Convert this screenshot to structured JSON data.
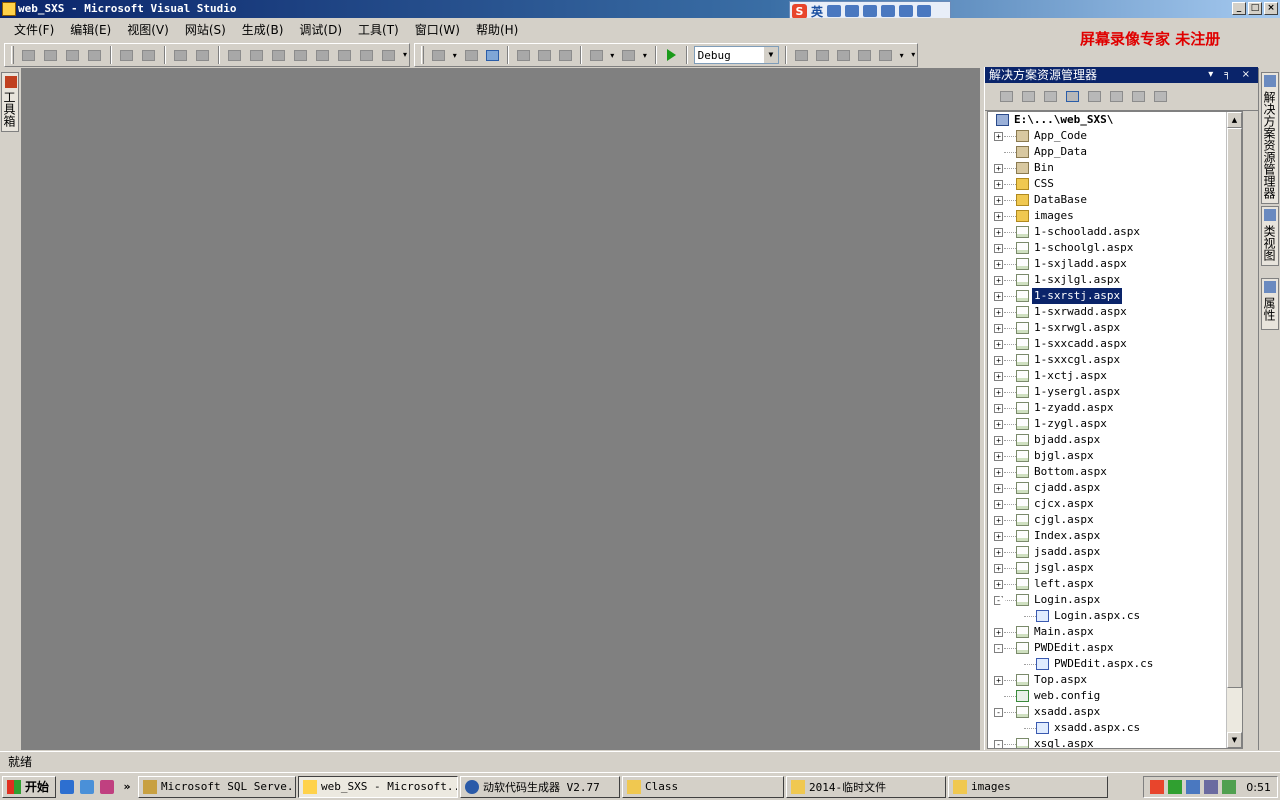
{
  "window": {
    "title": "web_SXS - Microsoft Visual Studio",
    "controls": [
      "_",
      "□",
      "×"
    ]
  },
  "ime_bar": {
    "logo": "S",
    "lang": "英"
  },
  "watermark": "屏幕录像专家  未注册",
  "menu": [
    "文件(F)",
    "编辑(E)",
    "视图(V)",
    "网站(S)",
    "生成(B)",
    "调试(D)",
    "工具(T)",
    "窗口(W)",
    "帮助(H)"
  ],
  "toolbar": {
    "config_value": "Debug",
    "overflow_label": "▾"
  },
  "toolbox": {
    "label": "工具箱"
  },
  "solution_explorer": {
    "title": "解决方案资源管理器",
    "title_controls": "▾ ╕ ×",
    "root": "E:\\...\\web_SXS\\",
    "items": [
      {
        "label": "App_Code",
        "icon": "folder-special-icon",
        "expand": "+"
      },
      {
        "label": "App_Data",
        "icon": "folder-special-icon",
        "expand": ""
      },
      {
        "label": "Bin",
        "icon": "folder-special-icon",
        "expand": "+"
      },
      {
        "label": "CSS",
        "icon": "folder-icon",
        "expand": "+"
      },
      {
        "label": "DataBase",
        "icon": "folder-icon",
        "expand": "+"
      },
      {
        "label": "images",
        "icon": "folder-icon",
        "expand": "+"
      },
      {
        "label": "1-schooladd.aspx",
        "icon": "aspx-page-icon",
        "expand": "+"
      },
      {
        "label": "1-schoolgl.aspx",
        "icon": "aspx-page-icon",
        "expand": "+"
      },
      {
        "label": "1-sxjladd.aspx",
        "icon": "aspx-page-icon",
        "expand": "+"
      },
      {
        "label": "1-sxjlgl.aspx",
        "icon": "aspx-page-icon",
        "expand": "+"
      },
      {
        "label": "1-sxrstj.aspx",
        "icon": "aspx-page-icon",
        "expand": "+",
        "selected": true
      },
      {
        "label": "1-sxrwadd.aspx",
        "icon": "aspx-page-icon",
        "expand": "+"
      },
      {
        "label": "1-sxrwgl.aspx",
        "icon": "aspx-page-icon",
        "expand": "+"
      },
      {
        "label": "1-sxxcadd.aspx",
        "icon": "aspx-page-icon",
        "expand": "+"
      },
      {
        "label": "1-sxxcgl.aspx",
        "icon": "aspx-page-icon",
        "expand": "+"
      },
      {
        "label": "1-xctj.aspx",
        "icon": "aspx-page-icon",
        "expand": "+"
      },
      {
        "label": "1-ysergl.aspx",
        "icon": "aspx-page-icon",
        "expand": "+"
      },
      {
        "label": "1-zyadd.aspx",
        "icon": "aspx-page-icon",
        "expand": "+"
      },
      {
        "label": "1-zygl.aspx",
        "icon": "aspx-page-icon",
        "expand": "+"
      },
      {
        "label": "bjadd.aspx",
        "icon": "aspx-page-icon",
        "expand": "+"
      },
      {
        "label": "bjgl.aspx",
        "icon": "aspx-page-icon",
        "expand": "+"
      },
      {
        "label": "Bottom.aspx",
        "icon": "aspx-page-icon",
        "expand": "+"
      },
      {
        "label": "cjadd.aspx",
        "icon": "aspx-page-icon",
        "expand": "+"
      },
      {
        "label": "cjcx.aspx",
        "icon": "aspx-page-icon",
        "expand": "+"
      },
      {
        "label": "cjgl.aspx",
        "icon": "aspx-page-icon",
        "expand": "+"
      },
      {
        "label": "Index.aspx",
        "icon": "aspx-page-icon",
        "expand": "+"
      },
      {
        "label": "jsadd.aspx",
        "icon": "aspx-page-icon",
        "expand": "+"
      },
      {
        "label": "jsgl.aspx",
        "icon": "aspx-page-icon",
        "expand": "+"
      },
      {
        "label": "left.aspx",
        "icon": "aspx-page-icon",
        "expand": "+"
      },
      {
        "label": "Login.aspx",
        "icon": "aspx-page-icon",
        "expand": "-"
      },
      {
        "label": "Login.aspx.cs",
        "icon": "cs-file-icon",
        "expand": "",
        "child": true
      },
      {
        "label": "Main.aspx",
        "icon": "aspx-page-icon",
        "expand": "+"
      },
      {
        "label": "PWDEdit.aspx",
        "icon": "aspx-page-icon",
        "expand": "-"
      },
      {
        "label": "PWDEdit.aspx.cs",
        "icon": "cs-file-icon",
        "expand": "",
        "child": true
      },
      {
        "label": "Top.aspx",
        "icon": "aspx-page-icon",
        "expand": "+"
      },
      {
        "label": "web.config",
        "icon": "config-file-icon",
        "expand": ""
      },
      {
        "label": "xsadd.aspx",
        "icon": "aspx-page-icon",
        "expand": "-"
      },
      {
        "label": "xsadd.aspx.cs",
        "icon": "cs-file-icon",
        "expand": "",
        "child": true
      },
      {
        "label": "xsgl.aspx",
        "icon": "aspx-page-icon",
        "expand": "-"
      }
    ]
  },
  "right_tabs": [
    "解决方案资源管理器",
    "类视图",
    "属性"
  ],
  "status": "就绪",
  "taskbar": {
    "start": "开始",
    "overflow": "»",
    "tasks": [
      {
        "label": "Microsoft SQL Serve...",
        "active": false
      },
      {
        "label": "web_SXS - Microsoft...",
        "active": true
      },
      {
        "label": "动软代码生成器    V2.77",
        "active": false
      },
      {
        "label": "Class",
        "active": false
      },
      {
        "label": "2014-临时文件",
        "active": false
      },
      {
        "label": "images",
        "active": false
      }
    ],
    "clock": "0:51"
  }
}
